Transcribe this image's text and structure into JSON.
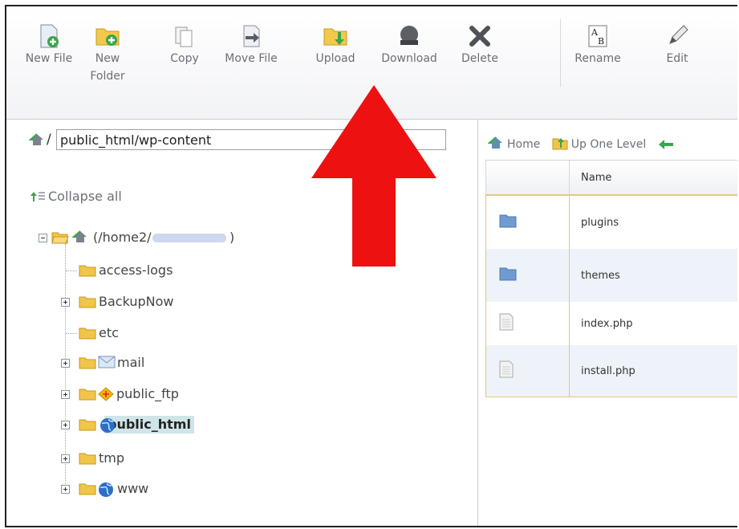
{
  "toolbar": {
    "buttons": [
      {
        "label": "New File",
        "icon": "new-file-icon"
      },
      {
        "label": "New\nFolder",
        "icon": "new-folder-icon"
      },
      {
        "label": "Copy",
        "icon": "copy-icon"
      },
      {
        "label": "Move File",
        "icon": "move-file-icon"
      },
      {
        "label": "Upload",
        "icon": "upload-icon"
      },
      {
        "label": "Download",
        "icon": "download-icon"
      },
      {
        "label": "Delete",
        "icon": "delete-icon"
      },
      {
        "label": "Rename",
        "icon": "rename-icon"
      },
      {
        "label": "Edit",
        "icon": "edit-icon"
      }
    ]
  },
  "path": {
    "separator": "/",
    "value": "public_html/wp-content"
  },
  "tree": {
    "collapse_all": "Collapse all",
    "root_label": "(/home2/",
    "root_label_end": ")",
    "items": [
      {
        "label": "access-logs",
        "expander": "none"
      },
      {
        "label": "BackupNow",
        "expander": "plus"
      },
      {
        "label": "etc",
        "expander": "none"
      },
      {
        "label": "mail",
        "expander": "plus"
      },
      {
        "label": "public_ftp",
        "expander": "plus"
      },
      {
        "label": "public_html",
        "expander": "plus",
        "selected": true
      },
      {
        "label": "tmp",
        "expander": "plus"
      },
      {
        "label": "www",
        "expander": "plus"
      }
    ]
  },
  "nav": {
    "home": "Home",
    "up_one_level": "Up One Level"
  },
  "files": {
    "header_name": "Name",
    "rows": [
      {
        "name": "plugins",
        "type": "folder"
      },
      {
        "name": "themes",
        "type": "folder"
      },
      {
        "name": "index.php",
        "type": "file"
      },
      {
        "name": "install.php",
        "type": "file"
      }
    ]
  },
  "colors": {
    "annotation_arrow": "#ee1111",
    "selection": "#cfe5e8",
    "folder": "#f0c64a"
  }
}
